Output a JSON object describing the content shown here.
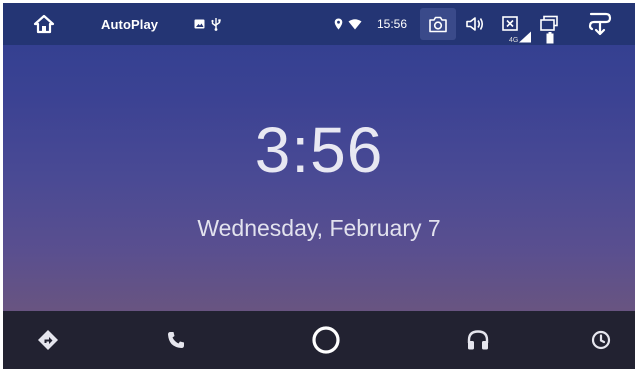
{
  "status_bar": {
    "app_title": "AutoPlay",
    "time": "15:56",
    "network_type": "4G",
    "icons": [
      "home-icon",
      "image-icon",
      "usb-icon",
      "location-icon",
      "wifi-icon",
      "camera-icon",
      "volume-icon",
      "close-box-icon",
      "signal-icon",
      "battery-icon",
      "recent-apps-icon",
      "exit-icon"
    ]
  },
  "main": {
    "time": "3:56",
    "date": "Wednesday, February 7"
  },
  "nav_bar": {
    "items": [
      "navigation-icon",
      "phone-icon",
      "home-circle-icon",
      "headphones-icon",
      "recent-icon"
    ]
  },
  "colors": {
    "status_bar_bg": "#243574",
    "nav_bar_bg": "#222231",
    "gradient_top": "#2f3f8f",
    "gradient_bottom": "#6f5674",
    "text": "#e8e8f2"
  }
}
